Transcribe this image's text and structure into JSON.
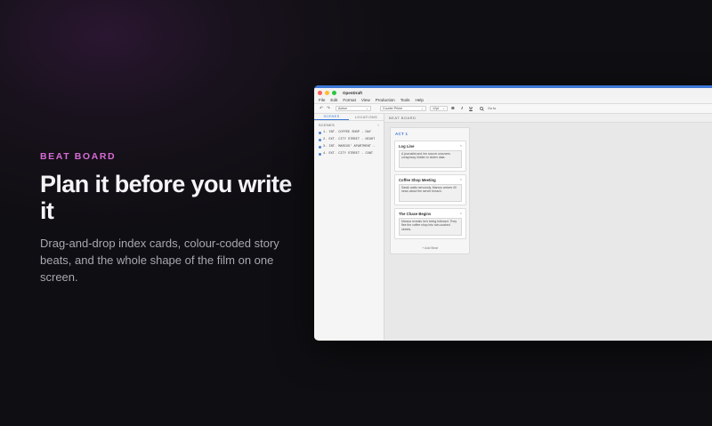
{
  "hero": {
    "eyebrow": "BEAT BOARD",
    "headline": "Plan it before you write it",
    "subline": "Drag-and-drop index cards, colour-coded story beats, and the whole shape of the film on one screen."
  },
  "app": {
    "title": "OpenDraft",
    "menu": [
      "File",
      "Edit",
      "Format",
      "View",
      "Production",
      "Tools",
      "Help"
    ],
    "toolbar": {
      "style_select": "Action",
      "font_select": "Courier Prime",
      "size_select": "12pt",
      "bold": "B",
      "italic": "I",
      "underline": "U",
      "search_label": "Go to"
    },
    "sidebar": {
      "tabs": [
        "SCENES",
        "LOCATIONS"
      ],
      "section_title": "SCENES",
      "collapse_icon": "‹",
      "scenes": [
        "1. INT. COFFEE SHOP - DAY",
        "2. EXT. CITY STREET - NIGHT",
        "3. INT. MARCUS' APARTMENT -",
        "4. EXT. CITY STREET - CONT"
      ]
    },
    "board": {
      "header": "BEAT BOARD",
      "act_title": "ACT 1",
      "cards": [
        {
          "title": "Log Line",
          "text": "A journalist and her source uncovers conspiracy hidden in stolen data."
        },
        {
          "title": "Coffee Shop Meeting",
          "text": "Sarah waits nervously. Marcus arrives 40 news about the server breach."
        },
        {
          "title": "The Chase Begins",
          "text": "Marcus reveals he's being followed. They flee the coffee shop into rain-soaked streets."
        }
      ],
      "add_beat": "+ Add Beat"
    }
  },
  "colors": {
    "accent": "#3d78d6",
    "eyebrow": "#d86bd6"
  }
}
